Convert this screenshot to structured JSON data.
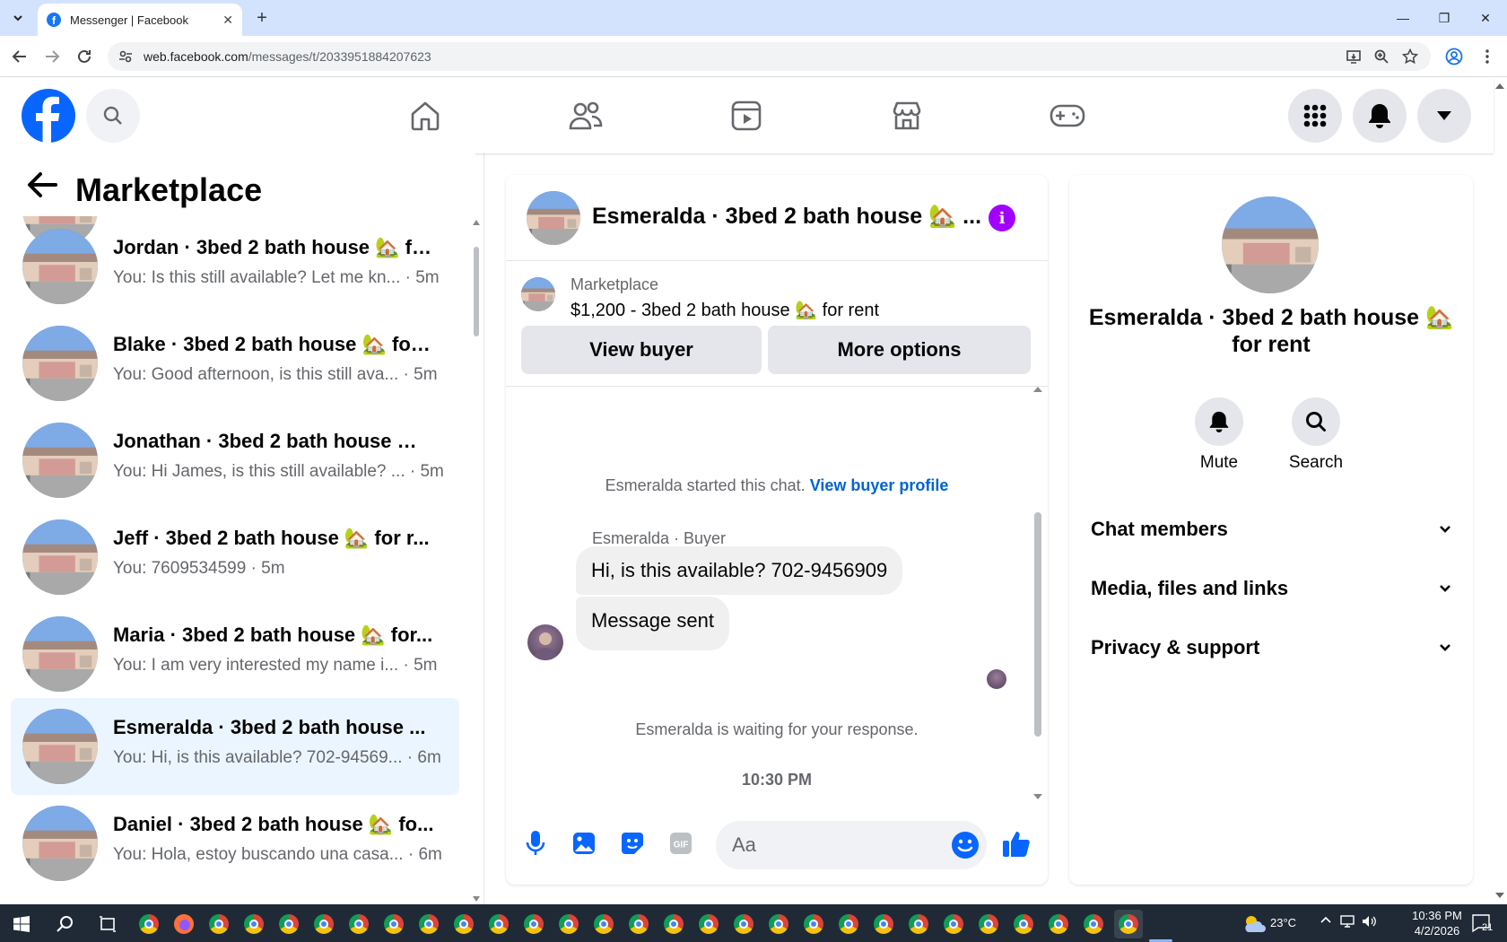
{
  "browser": {
    "tab_title": "Messenger | Facebook",
    "url_host": "web.facebook.com",
    "url_path": "/messages/t/2033951884207623"
  },
  "left_panel": {
    "title": "Marketplace",
    "conversations": [
      {
        "name": "Jordan · 3bed 2 bath house 🏡 fo...",
        "preview": "You: Is this still available? Let me kn... · 5m"
      },
      {
        "name": "Blake · 3bed 2 bath house 🏡 for ...",
        "preview": "You: Good afternoon, is this still ava... · 5m"
      },
      {
        "name": "Jonathan · 3bed 2 bath house 🏡...",
        "preview": "You: Hi James, is this still available? ... · 5m"
      },
      {
        "name": "Jeff · 3bed 2 bath house 🏡 for r...",
        "preview": "You: 7609534599 · 5m"
      },
      {
        "name": "Maria · 3bed 2 bath house 🏡 for...",
        "preview": "You: I am very interested my name i... · 5m"
      },
      {
        "name": "Esmeralda · 3bed 2 bath house ...",
        "preview": "You: Hi, is this available? 702-94569... · 6m"
      },
      {
        "name": "Daniel · 3bed 2 bath house 🏡 fo...",
        "preview": "You: Hola, estoy buscando una casa... · 6m"
      }
    ]
  },
  "chat": {
    "header_name": "Esmeralda · 3bed 2 bath house 🏡 ...",
    "marketplace_label": "Marketplace",
    "listing": "$1,200 - 3bed 2 bath house 🏡 for rent",
    "view_buyer": "View buyer",
    "more_options": "More options",
    "started_text": "Esmeralda started this chat.",
    "view_buyer_profile": "View buyer profile",
    "sender_label": "Esmeralda · Buyer",
    "message_1": "Hi, is this available? 702-9456909",
    "message_2": "Message sent",
    "waiting_text": "Esmeralda is waiting for your response.",
    "timestamp": "10:30 PM",
    "input_placeholder": "Aa"
  },
  "right_panel": {
    "title": "Esmeralda · 3bed 2 bath house 🏡 for rent",
    "mute": "Mute",
    "search": "Search",
    "sections": [
      "Chat members",
      "Media, files and links",
      "Privacy & support"
    ]
  },
  "taskbar": {
    "weather": "23°C",
    "time": "10:36 PM",
    "date": "4/2/2026",
    "notifications": "21"
  },
  "colors": {
    "accent": "#0866ff",
    "active_row": "#ebf5ff",
    "info": "#a100ff"
  }
}
